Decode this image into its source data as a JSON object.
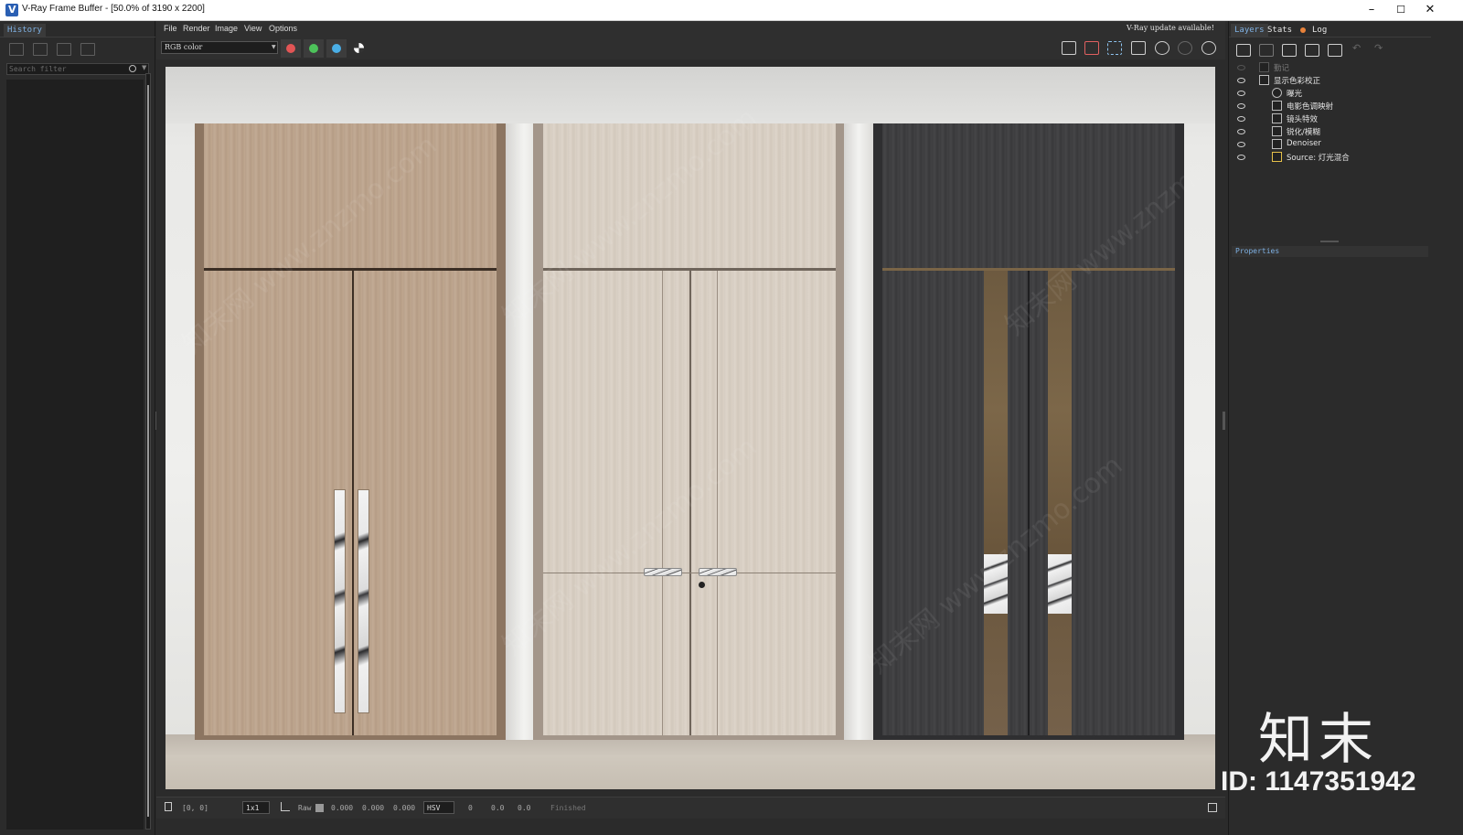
{
  "window": {
    "title": "V-Ray Frame Buffer - [50.0% of 3190 x 2200]",
    "controls": [
      "–",
      "☐",
      "✕"
    ]
  },
  "history_panel": {
    "tab_label": "History",
    "search_placeholder": "Search filter"
  },
  "menu": {
    "items": [
      "File",
      "Render",
      "Image",
      "View",
      "Options"
    ],
    "update_notice": "V-Ray update available!"
  },
  "toolbar": {
    "channel_select": "RGB color",
    "channel_buttons": [
      {
        "name": "red-channel",
        "color": "#e25555"
      },
      {
        "name": "green-channel",
        "color": "#4dc25a"
      },
      {
        "name": "blue-channel",
        "color": "#4aaee6"
      }
    ],
    "right_icons": [
      "save-image-icon",
      "clear-image-icon",
      "region-render-icon",
      "track-mouse-icon",
      "render-icon",
      "interactive-render-icon",
      "stop-render-icon"
    ]
  },
  "status_bar": {
    "coords": "[0, 0]",
    "zoom": "1x1",
    "raw_label": "Raw",
    "rgb_values": [
      "0.000",
      "0.000",
      "0.000"
    ],
    "color_mode": "HSV",
    "hsv_values": [
      "0",
      "0.0",
      "0.0"
    ],
    "status": "Finished"
  },
  "right_panel": {
    "tabs": [
      "Layers",
      "Stats",
      "Log"
    ],
    "layers": [
      {
        "label": "勤记",
        "visible": false,
        "indent": 0
      },
      {
        "label": "显示色彩校正",
        "visible": true,
        "indent": 0
      },
      {
        "label": "曝光",
        "visible": true,
        "indent": 1
      },
      {
        "label": "电影色调映射",
        "visible": true,
        "indent": 1
      },
      {
        "label": "镜头特效",
        "visible": true,
        "indent": 1
      },
      {
        "label": "锐化/模糊",
        "visible": true,
        "indent": 1
      },
      {
        "label": "Denoiser",
        "visible": true,
        "indent": 1
      },
      {
        "label": "Source: 灯光混合",
        "visible": true,
        "indent": 1
      }
    ],
    "properties_label": "Properties"
  },
  "overlay": {
    "logo": "知末",
    "id_text": "ID: 1147351942",
    "watermark": "知末网 www.znzmo.com"
  },
  "colors": {
    "accent_tab": "#7fb2e5",
    "log_dot": "#e8823a",
    "panel_bg": "#2b2b2b"
  }
}
